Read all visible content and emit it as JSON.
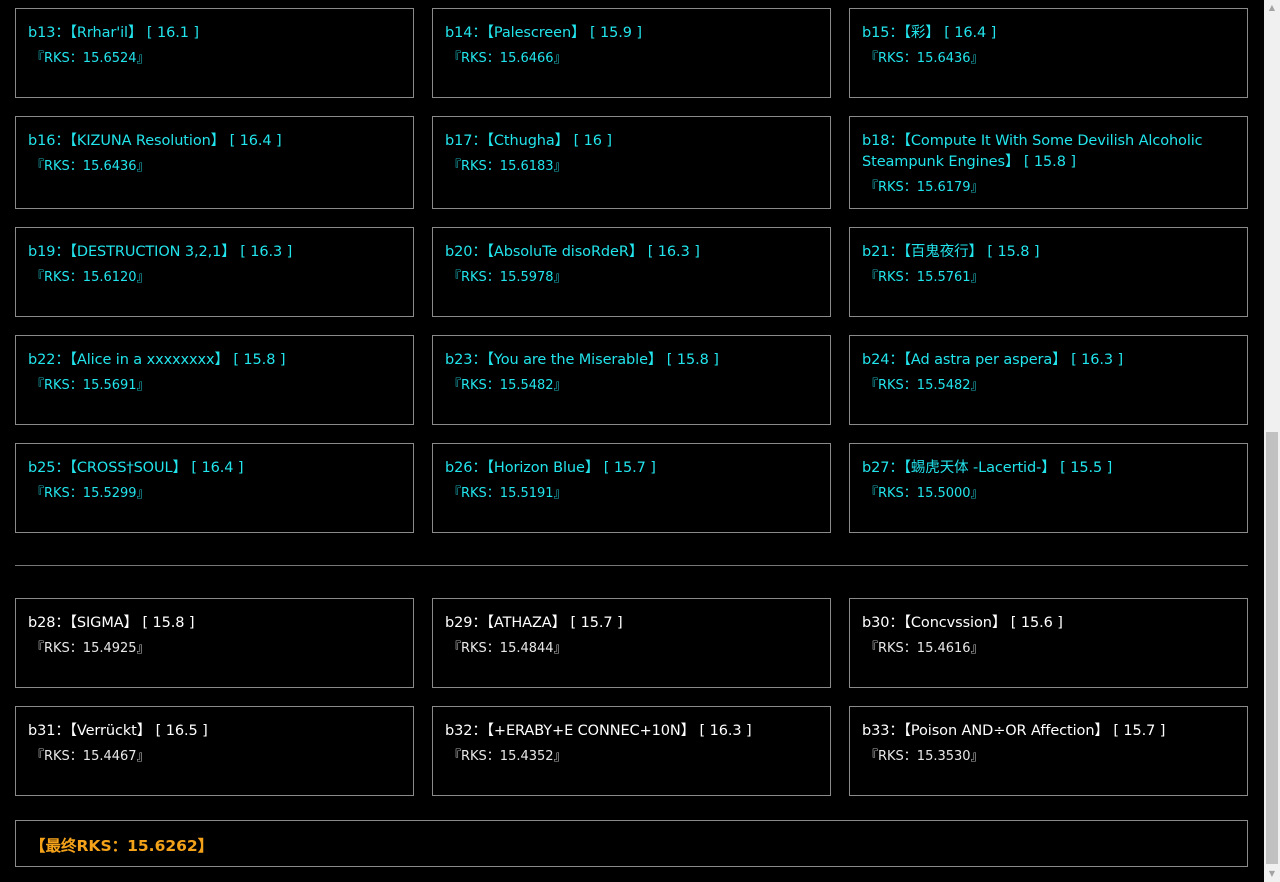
{
  "cards": [
    {
      "title": "b13：【Rrhar'il】 [ 16.1 ]",
      "rks": "『RKS：15.6524』",
      "theme": "cyan"
    },
    {
      "title": "b14：【Palescreen】 [ 15.9 ]",
      "rks": "『RKS：15.6466』",
      "theme": "cyan"
    },
    {
      "title": "b15：【彩】 [ 16.4 ]",
      "rks": "『RKS：15.6436』",
      "theme": "cyan"
    },
    {
      "title": "b16：【KIZUNA Resolution】 [ 16.4 ]",
      "rks": "『RKS：15.6436』",
      "theme": "cyan"
    },
    {
      "title": "b17：【Cthugha】 [ 16 ]",
      "rks": "『RKS：15.6183』",
      "theme": "cyan"
    },
    {
      "title": "b18：【Compute It With Some Devilish Alcoholic Steampunk Engines】 [ 15.8 ]",
      "rks": "『RKS：15.6179』",
      "theme": "cyan"
    },
    {
      "title": "b19：【DESTRUCTION 3,2,1】 [ 16.3 ]",
      "rks": "『RKS：15.6120』",
      "theme": "cyan"
    },
    {
      "title": "b20：【AbsoluTe disoRdeR】 [ 16.3 ]",
      "rks": "『RKS：15.5978』",
      "theme": "cyan"
    },
    {
      "title": "b21：【百鬼夜行】 [ 15.8 ]",
      "rks": "『RKS：15.5761』",
      "theme": "cyan"
    },
    {
      "title": "b22：【Alice in a xxxxxxxx】 [ 15.8 ]",
      "rks": "『RKS：15.5691』",
      "theme": "cyan"
    },
    {
      "title": "b23：【You are the Miserable】 [ 15.8 ]",
      "rks": "『RKS：15.5482』",
      "theme": "cyan"
    },
    {
      "title": "b24：【Ad astra per aspera】 [ 16.3 ]",
      "rks": "『RKS：15.5482』",
      "theme": "cyan"
    },
    {
      "title": "b25：【CROSS†SOUL】 [ 16.4 ]",
      "rks": "『RKS：15.5299』",
      "theme": "cyan"
    },
    {
      "title": "b26：【Horizon Blue】 [ 15.7 ]",
      "rks": "『RKS：15.5191』",
      "theme": "cyan"
    },
    {
      "title": "b27：【蜴虎天体 -Lacertid-】 [ 15.5 ]",
      "rks": "『RKS：15.5000』",
      "theme": "cyan"
    },
    {
      "title": "b28：【SIGMA】 [ 15.8 ]",
      "rks": "『RKS：15.4925』",
      "theme": "white"
    },
    {
      "title": "b29：【ATHAZA】 [ 15.7 ]",
      "rks": "『RKS：15.4844』",
      "theme": "white"
    },
    {
      "title": "b30：【Concvssion】 [ 15.6 ]",
      "rks": "『RKS：15.4616』",
      "theme": "white"
    },
    {
      "title": "b31：【Verrückt】 [ 16.5 ]",
      "rks": "『RKS：15.4467』",
      "theme": "white"
    },
    {
      "title": "b32：【+ERABY+E CONNEC+10N】 [ 16.3 ]",
      "rks": "『RKS：15.4352』",
      "theme": "white"
    },
    {
      "title": "b33：【Poison AND÷OR Affection】 [ 15.7 ]",
      "rks": "『RKS：15.3530』",
      "theme": "white"
    }
  ],
  "final": {
    "label": "【最终RKS：15.6262】"
  },
  "colors": {
    "cyan": "#22e4ec",
    "white": "#ffffff",
    "orange": "#f4a21a",
    "border": "#8a8a8a",
    "background": "#000000"
  },
  "scrollbar": {
    "up_icon": "scroll-up-arrow-icon",
    "down_icon": "scroll-down-arrow-icon"
  }
}
